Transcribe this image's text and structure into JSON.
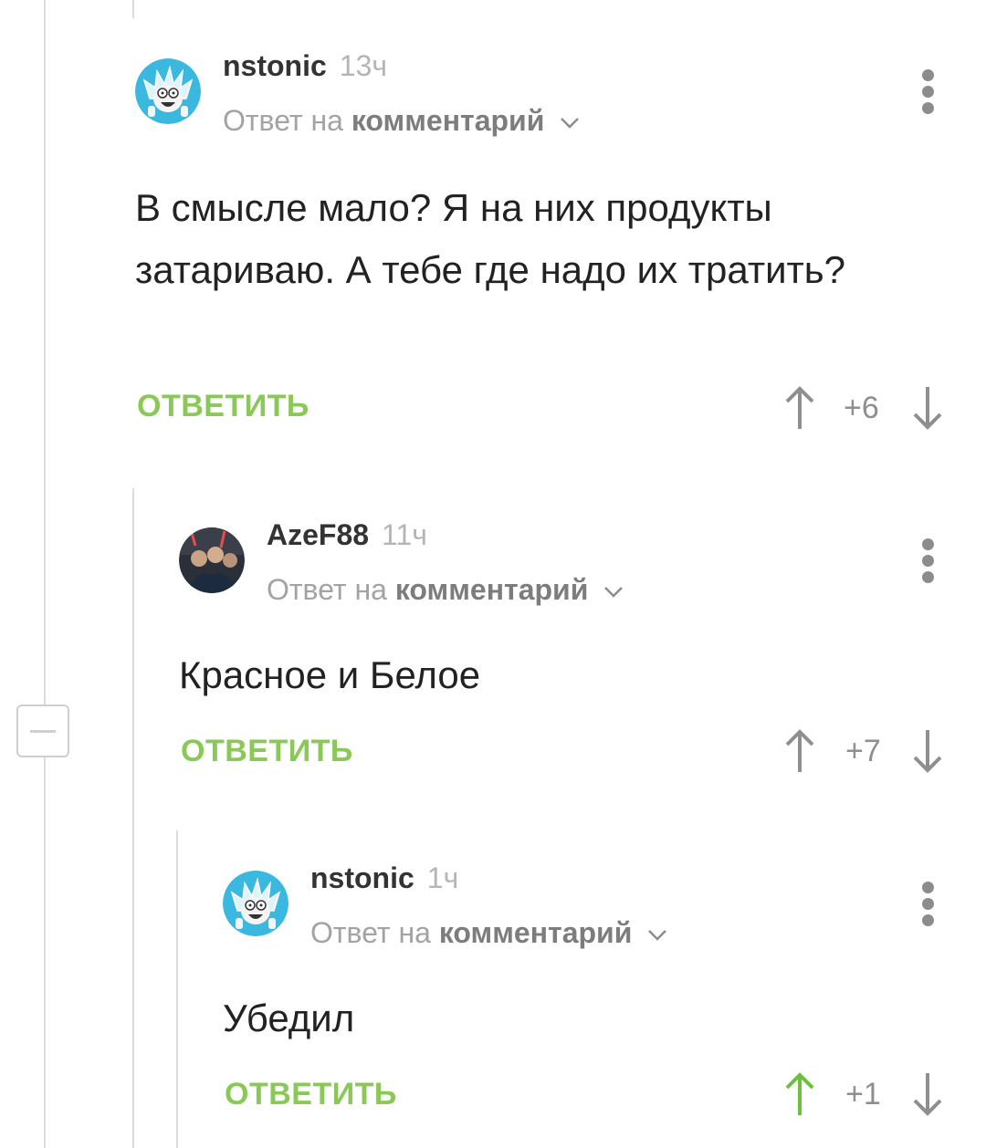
{
  "comments": [
    {
      "author": "nstonic",
      "time": "13ч",
      "reply_prefix": "Ответ на",
      "reply_target": "комментарий",
      "text": "В смысле мало? Я на них продукты затариваю. А тебе где надо их тратить?",
      "reply_label": "ОТВЕТИТЬ",
      "score": "+6",
      "upvoted": false,
      "avatar_icon": "rick-avatar-icon"
    },
    {
      "author": "AzeF88",
      "time": "11ч",
      "reply_prefix": "Ответ на",
      "reply_target": "комментарий",
      "text": "Красное и Белое",
      "reply_label": "ОТВЕТИТЬ",
      "score": "+7",
      "upvoted": false,
      "avatar_icon": "photo-avatar-icon"
    },
    {
      "author": "nstonic",
      "time": "1ч",
      "reply_prefix": "Ответ на",
      "reply_target": "комментарий",
      "text": "Убедил",
      "reply_label": "ОТВЕТИТЬ",
      "score": "+1",
      "upvoted": true,
      "avatar_icon": "rick-avatar-icon"
    }
  ],
  "colors": {
    "accent_green": "#8ac858",
    "upvote_active": "#6cc03c",
    "muted": "#a3a3a3",
    "thread_line": "#dcdcdc"
  }
}
